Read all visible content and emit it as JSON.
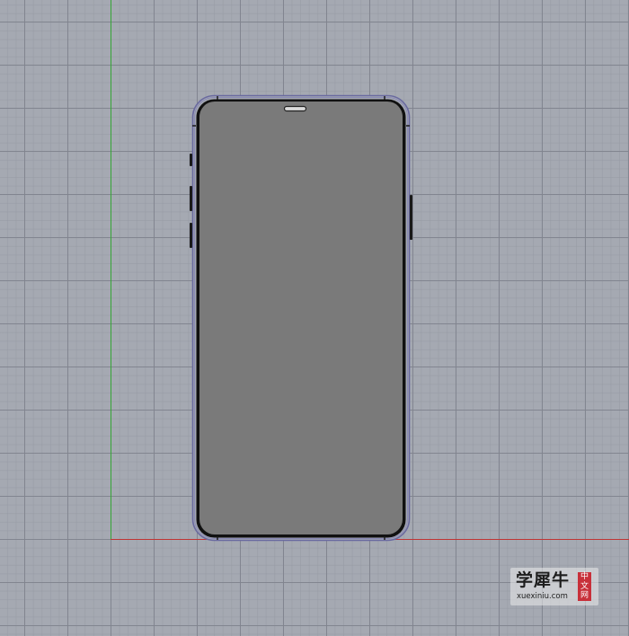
{
  "viewport": {
    "background_color": "#a5a9b2",
    "axis_x_color": "#c03535",
    "axis_y_color": "#35a535"
  },
  "phone_model": {
    "body_outline_color": "#6a6aa0",
    "screen_color": "#7a7a7a",
    "bezel_color": "#111111",
    "speaker_grille_color": "#dcdcdc"
  },
  "watermark": {
    "chinese_text": "学犀牛",
    "url": "xuexiniu.com",
    "seal": [
      "中",
      "文",
      "网"
    ],
    "seal_color": "#c8303a"
  }
}
